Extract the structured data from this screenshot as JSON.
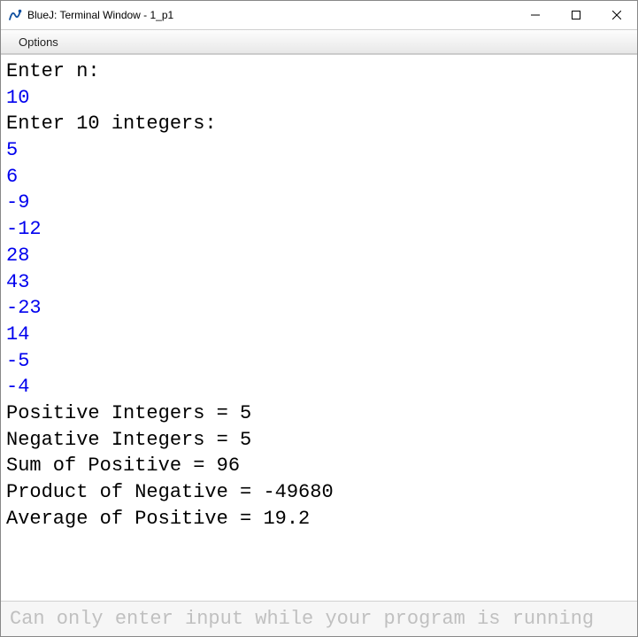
{
  "window": {
    "title": "BlueJ: Terminal Window - 1_p1"
  },
  "menubar": {
    "options_label": "Options"
  },
  "terminal": {
    "lines": [
      {
        "type": "output",
        "text": "Enter n:"
      },
      {
        "type": "input",
        "text": "10"
      },
      {
        "type": "output",
        "text": "Enter 10 integers:"
      },
      {
        "type": "input",
        "text": "5"
      },
      {
        "type": "input",
        "text": "6"
      },
      {
        "type": "input",
        "text": "-9"
      },
      {
        "type": "input",
        "text": "-12"
      },
      {
        "type": "input",
        "text": "28"
      },
      {
        "type": "input",
        "text": "43"
      },
      {
        "type": "input",
        "text": "-23"
      },
      {
        "type": "input",
        "text": "14"
      },
      {
        "type": "input",
        "text": "-5"
      },
      {
        "type": "input",
        "text": "-4"
      },
      {
        "type": "output",
        "text": "Positive Integers = 5"
      },
      {
        "type": "output",
        "text": "Negative Integers = 5"
      },
      {
        "type": "output",
        "text": "Sum of Positive = 96"
      },
      {
        "type": "output",
        "text": "Product of Negative = -49680"
      },
      {
        "type": "output",
        "text": "Average of Positive = 19.2"
      }
    ]
  },
  "status": {
    "message": "Can only enter input while your program is running"
  }
}
